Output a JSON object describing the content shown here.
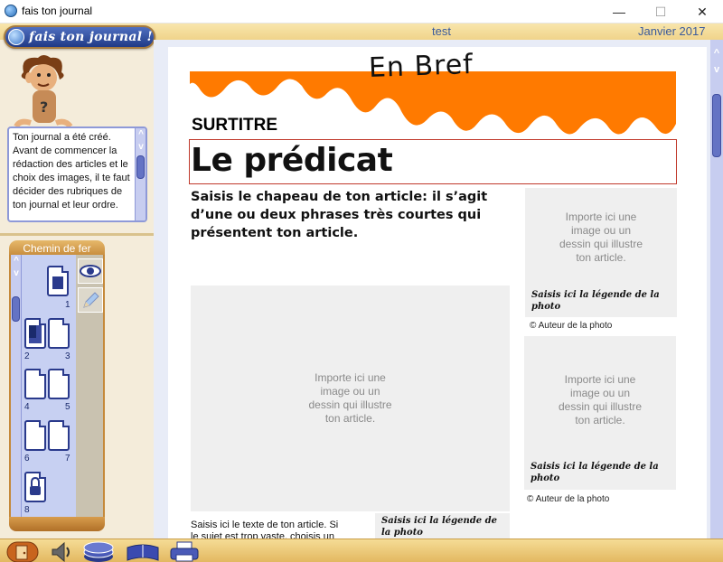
{
  "window": {
    "title": "fais ton journal",
    "minimize": "—",
    "maximize": "☐",
    "close": "✕"
  },
  "header": {
    "logo_text": "fais ton journal !",
    "user": "test",
    "date": "Janvier 2017"
  },
  "help": {
    "text": "Ton journal a été créé. Avant de commencer la rédaction des articles et le choix des images, il te faut décider des rubriques de ton journal et leur ordre."
  },
  "chemin": {
    "title": "Chemin de fer",
    "pages": [
      "1",
      "2",
      "3",
      "4",
      "5",
      "6",
      "7",
      "8"
    ]
  },
  "scroll": {
    "up": "^",
    "down": "v"
  },
  "article": {
    "banner": "En Bref",
    "surtitre": "SURTITRE",
    "headline": "Le prédicat",
    "chapeau": "Saisis le chapeau de ton article: il s’agit d’une ou deux phrases très courtes qui présentent ton article.",
    "image_placeholder": "Importe ici une image ou un dessin qui illustre ton article.",
    "caption": "Saisis ici la légende de la photo",
    "author": "©  Auteur de la photo",
    "body": "Saisis ici le texte de ton article. Si le sujet est trop vaste, choisis un aspect"
  },
  "colors": {
    "banner_orange": "#ff7a00",
    "headline_border": "#c0392b",
    "accent_blue": "#2a3a8c"
  }
}
